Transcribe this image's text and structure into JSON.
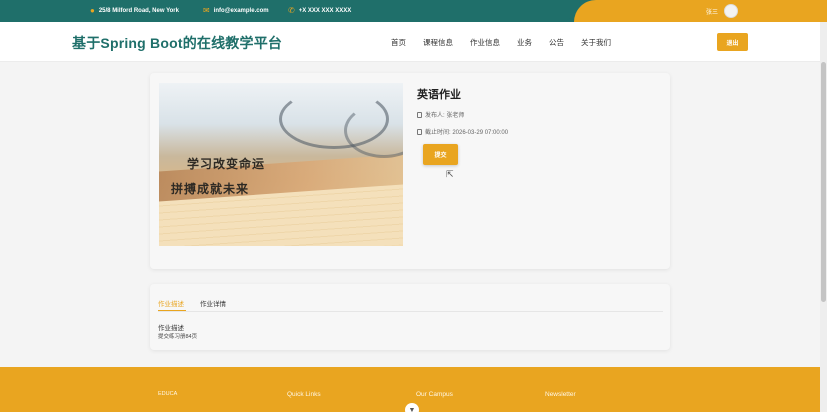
{
  "topbar": {
    "address": "25/8 Milford Road, New York",
    "email": "info@example.com",
    "phone": "+X XXX XXX XXXX",
    "username": "张三"
  },
  "header": {
    "logo": "基于Spring Boot的在线教学平台",
    "nav": [
      "首页",
      "课程信息",
      "作业信息",
      "业务",
      "公告",
      "关于我们"
    ],
    "logout": "退出"
  },
  "homework": {
    "image_text_line1": "学习改变命运",
    "image_text_line2": "拼搏成就未来",
    "title": "英语作业",
    "publisher": "发布人: 张老师",
    "deadline": "截止时间: 2026-03-29 07:00:00",
    "submit_label": "提交"
  },
  "tabs": {
    "items": [
      "作业描述",
      "作业详情"
    ],
    "active": "作业描述",
    "content_title": "作业描述",
    "content_text": "提交练习册84页"
  },
  "footer": {
    "columns": [
      "EDUCA",
      "Quick Links",
      "Our Campus",
      "Newsletter"
    ]
  },
  "colors": {
    "teal": "#1f6f6a",
    "accent": "#e9a520"
  }
}
